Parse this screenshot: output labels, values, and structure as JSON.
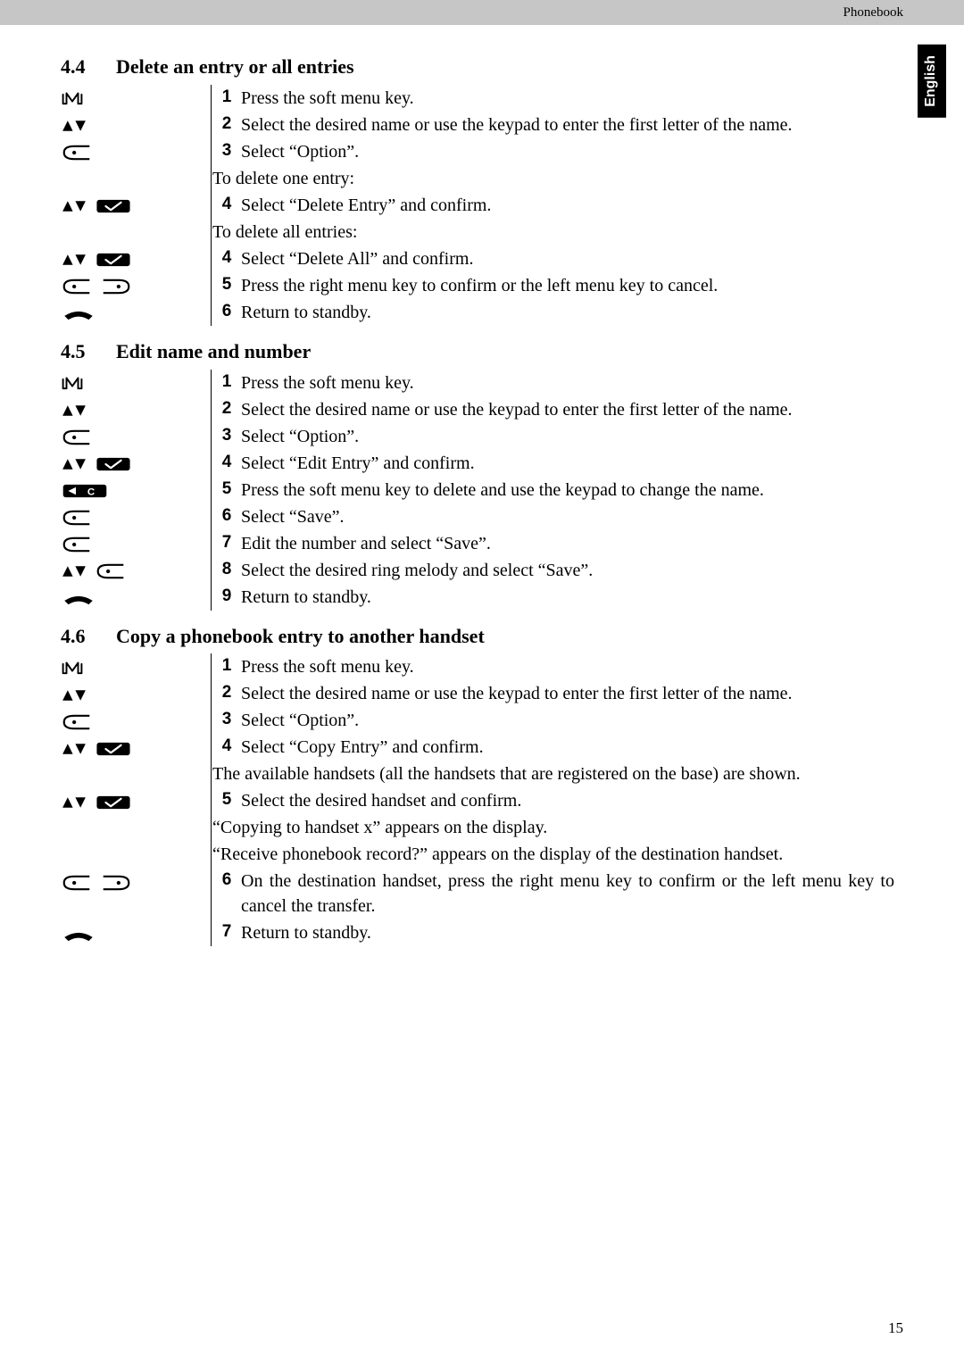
{
  "page": {
    "header_label": "Phonebook",
    "side_tab": "English",
    "page_number": "15"
  },
  "s44": {
    "num": "4.4",
    "title": "Delete an entry or all entries",
    "steps": {
      "1": "Press the soft menu key.",
      "2": "Select the desired name or use the keypad to enter the first letter of the name.",
      "3": "Select “Option”.",
      "sub1": "To delete one entry:",
      "4a": "Select “Delete Entry” and confirm.",
      "sub2": "To delete all entries:",
      "4b": "Select “Delete All” and confirm.",
      "5": "Press the right menu key to confirm or the left menu key to cancel.",
      "6": "Return to standby."
    }
  },
  "s45": {
    "num": "4.5",
    "title": "Edit name and number",
    "steps": {
      "1": "Press the soft menu key.",
      "2": "Select the desired name or use the keypad to enter the first letter of the name.",
      "3": "Select “Option”.",
      "4": "Select “Edit Entry” and confirm.",
      "5": "Press the soft menu key to delete and use the keypad to change the name.",
      "6": "Select “Save”.",
      "7": "Edit the number and select “Save”.",
      "8": "Select the desired ring melody and select “Save”.",
      "9": "Return to standby."
    }
  },
  "s46": {
    "num": "4.6",
    "title": "Copy a phonebook entry to another handset",
    "steps": {
      "1": "Press the soft menu key.",
      "2": "Select the desired name or use the keypad to enter the first letter of the name.",
      "3": "Select “Option”.",
      "4": "Select “Copy Entry” and confirm.",
      "sub1": "The available handsets (all the handsets that are registered on the base) are shown.",
      "5": "Select the desired handset and confirm.",
      "sub2": "“Copying to handset x” appears on the display.",
      "sub3": "“Receive phonebook record?” appears on the display of the destination handset.",
      "6": "On the destination handset, press the right menu key to confirm or the left menu key to cancel the transfer.",
      "7": "Return to standby."
    }
  },
  "nums": {
    "1": "1",
    "2": "2",
    "3": "3",
    "4": "4",
    "5": "5",
    "6": "6",
    "7": "7",
    "8": "8",
    "9": "9"
  }
}
